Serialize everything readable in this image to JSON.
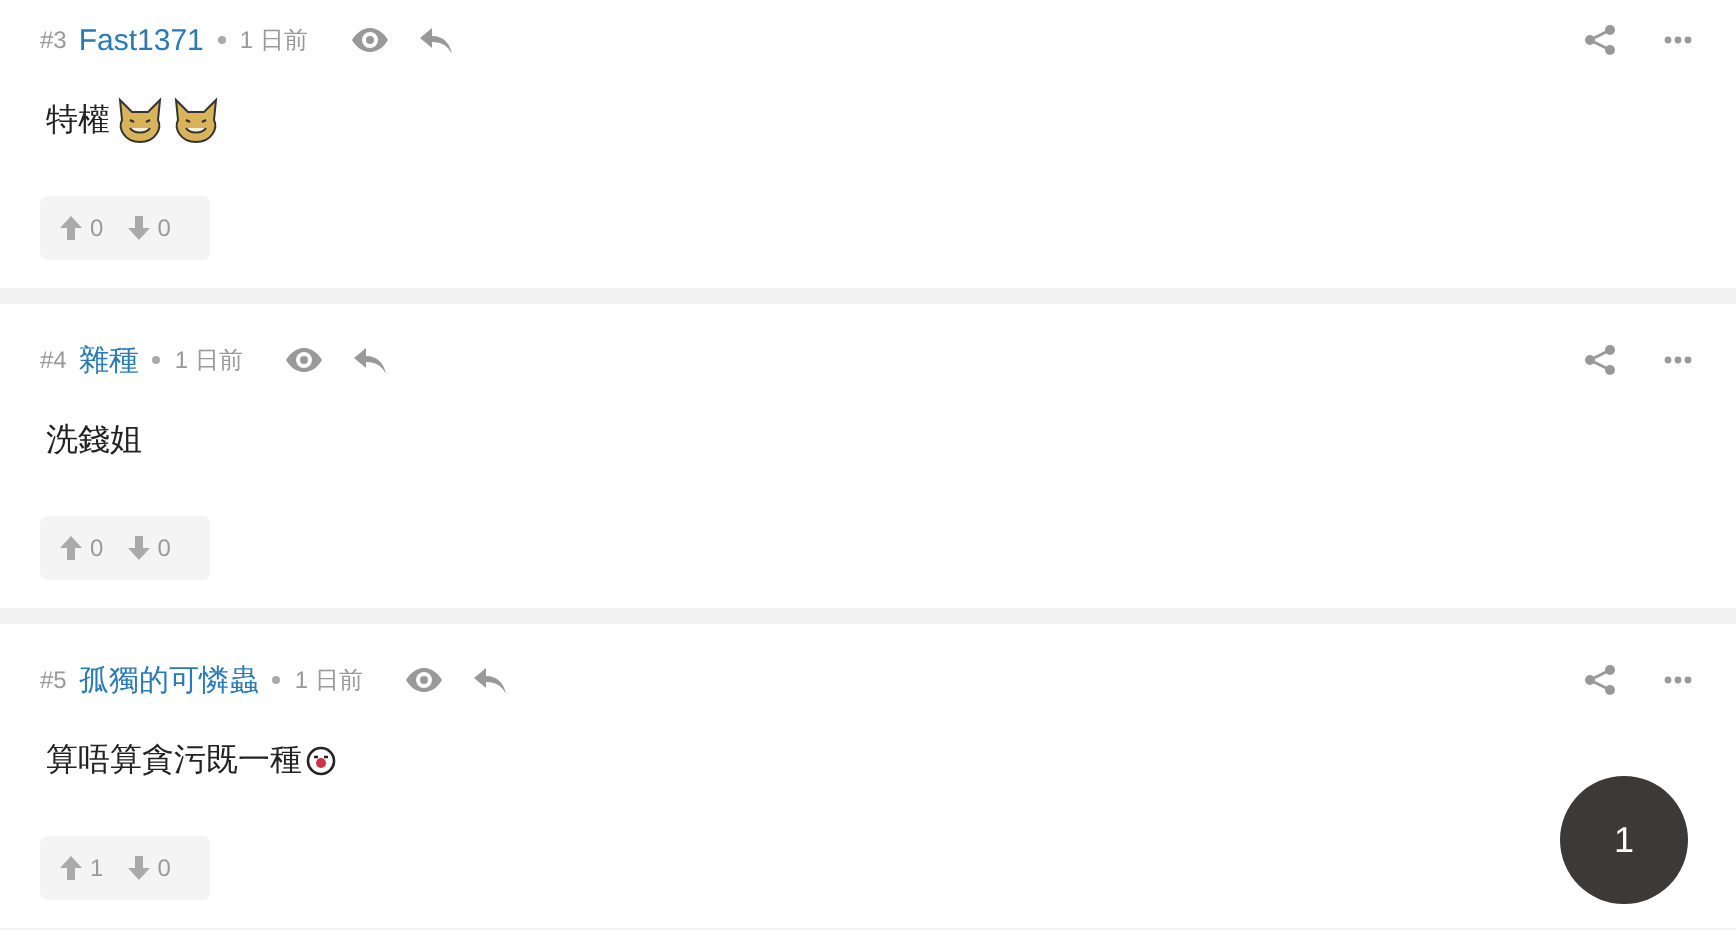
{
  "posts": [
    {
      "number": "#3",
      "author": "Fast1371",
      "time": "1 日前",
      "text": "特權",
      "stickers": [
        {
          "kind": "cat"
        },
        {
          "kind": "cat"
        }
      ],
      "upvotes": "0",
      "downvotes": "0"
    },
    {
      "number": "#4",
      "author": "雜種",
      "time": "1 日前",
      "text": "洗錢姐",
      "upvotes": "0",
      "downvotes": "0"
    },
    {
      "number": "#5",
      "author": "孤獨的可憐蟲",
      "time": "1 日前",
      "text": "算唔算貪污既一種",
      "stickers": [
        {
          "kind": "smiley"
        }
      ],
      "upvotes": "1",
      "downvotes": "0"
    }
  ],
  "page_badge": "1"
}
